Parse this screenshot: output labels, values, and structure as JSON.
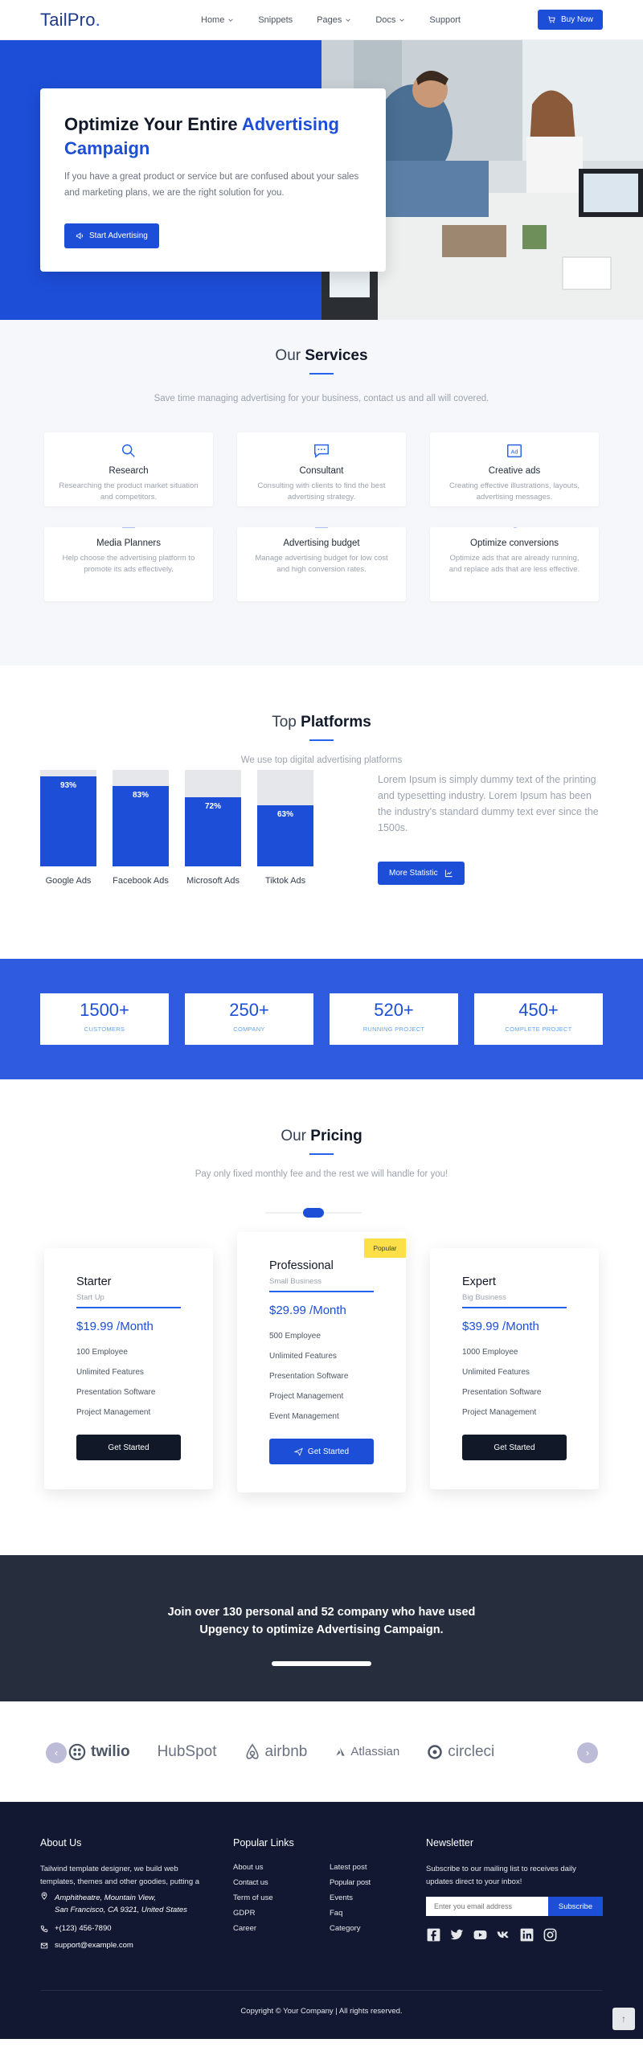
{
  "nav": {
    "logo_text": "TailPro",
    "logo_dot": ".",
    "items": [
      {
        "label": "Home",
        "dropdown": true
      },
      {
        "label": "Snippets",
        "dropdown": false
      },
      {
        "label": "Pages",
        "dropdown": true
      },
      {
        "label": "Docs",
        "dropdown": true
      },
      {
        "label": "Support",
        "dropdown": false
      }
    ],
    "buy_label": "Buy Now"
  },
  "hero": {
    "title_plain": "Optimize Your Entire ",
    "title_accent": "Advertising Campaign",
    "text": "If you have a great product or service but are confused about your sales and marketing plans, we are the right solution for you.",
    "button_label": "Start Advertising"
  },
  "services": {
    "title_plain": "Our ",
    "title_bold": "Services",
    "subtitle": "Save time managing advertising for your business, contact us and all will covered.",
    "cards": [
      {
        "icon": "search-icon",
        "title": "Research",
        "desc": "Researching the product market situation and competitors."
      },
      {
        "icon": "chat-icon",
        "title": "Consultant",
        "desc": "Consulting with clients to find the best advertising strategy."
      },
      {
        "icon": "ad-icon",
        "title": "Creative ads",
        "desc": "Creating effective illustrations, layouts, advertising messages."
      },
      {
        "icon": "planner-icon",
        "title": "Media Planners",
        "desc": "Help choose the advertising platform to promote its ads effectively."
      },
      {
        "icon": "budget-icon",
        "title": "Advertising budget",
        "desc": "Manage advertising budget for low cost and high conversion rates."
      },
      {
        "icon": "conversion-icon",
        "title": "Optimize conversions",
        "desc": "Optimize ads that are already running, and replace ads that are less effective."
      }
    ]
  },
  "platforms": {
    "title_plain": "Top ",
    "title_bold": "Platforms",
    "subtitle": "We use top digital advertising platforms",
    "text": "Lorem Ipsum is simply dummy text of the printing and typesetting industry. Lorem Ipsum has been the industry's standard dummy text ever since the 1500s.",
    "button_label": "More Statistic"
  },
  "chart_data": {
    "type": "bar",
    "categories": [
      "Google Ads",
      "Facebook Ads",
      "Microsoft Ads",
      "Tiktok Ads"
    ],
    "values": [
      93,
      83,
      72,
      63
    ],
    "value_labels": [
      "93%",
      "83%",
      "72%",
      "63%"
    ],
    "ylim": [
      0,
      100
    ],
    "title": "",
    "xlabel": "",
    "ylabel": "",
    "colors": {
      "fill": "#1d4ed8",
      "track": "#e5e7eb"
    }
  },
  "counters": [
    {
      "value": "1500+",
      "label": "CUSTOMERS"
    },
    {
      "value": "250+",
      "label": "COMPANY"
    },
    {
      "value": "520+",
      "label": "RUNNING PROJECT"
    },
    {
      "value": "450+",
      "label": "COMPLETE PROJECT"
    }
  ],
  "pricing": {
    "title_plain": "Our ",
    "title_bold": "Pricing",
    "subtitle": "Pay only fixed monthly fee and the rest we will handle for you!",
    "plans": [
      {
        "name": "Starter",
        "sub": "Start Up",
        "price": "$19.99 /Month",
        "features": [
          "100 Employee",
          "Unlimited Features",
          "Presentation Software",
          "Project Management"
        ],
        "button": "Get Started",
        "popular": ""
      },
      {
        "name": "Professional",
        "sub": "Small Business",
        "price": "$29.99 /Month",
        "features": [
          "500 Employee",
          "Unlimited Features",
          "Presentation Software",
          "Project Management",
          "Event Management"
        ],
        "button": "Get Started",
        "popular": "Popular"
      },
      {
        "name": "Expert",
        "sub": "Big Business",
        "price": "$39.99 /Month",
        "features": [
          "1000 Employee",
          "Unlimited Features",
          "Presentation Software",
          "Project Management"
        ],
        "button": "Get Started",
        "popular": ""
      }
    ]
  },
  "join": {
    "text_line1": "Join over 130 personal and 52 company who have used",
    "text_line2": "Upgency to optimize Advertising Campaign."
  },
  "clients": {
    "logos": [
      "twilio",
      "HubSpot",
      "airbnb",
      "Atlassian",
      "circleci"
    ]
  },
  "footer": {
    "about_head": "About Us",
    "about_text": "Tailwind template designer, we build web templates, themes and other goodies, putting a smile on your face.",
    "address_line1": "Amphitheatre, Mountain View,",
    "address_line2": "San Francisco, CA 9321, United States",
    "phone": "+(123) 456-7890",
    "email": "support@example.com",
    "links_head": "Popular Links",
    "links": [
      "About us",
      "Latest post",
      "Contact us",
      "Popular post",
      "Term of use",
      "Events",
      "GDPR",
      "Faq",
      "Career",
      "Category"
    ],
    "newsletter_head": "Newsletter",
    "newsletter_text": "Subscribe to our mailing list to receives daily updates direct to your inbox!",
    "email_placeholder": "Enter you email address",
    "subscribe_label": "Subscribe",
    "socials": [
      "facebook-icon",
      "twitter-icon",
      "youtube-icon",
      "vk-icon",
      "linkedin-icon",
      "instagram-icon"
    ],
    "copyright": "Copyright © Your Company | All rights reserved.",
    "to_top": "↑"
  },
  "colors": {
    "primary": "#1d4ed8",
    "dark": "#111827",
    "footer_bg": "#121831",
    "join_bg": "#262d3d",
    "popular": "#fde047"
  }
}
